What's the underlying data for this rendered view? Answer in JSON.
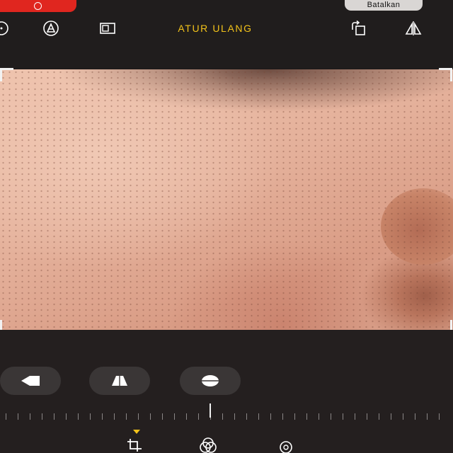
{
  "header": {
    "cancel_label": "Batalkan",
    "reset_label": "ATUR ULANG",
    "tools": [
      "auto-enhance-icon",
      "markup-icon",
      "aspect-ratio-icon",
      "rotate-icon",
      "flip-icon"
    ]
  },
  "photo": {
    "subject": ""
  },
  "adjustments": {
    "buttons": [
      "straighten-icon",
      "vertical-perspective-icon",
      "horizontal-perspective-icon"
    ]
  },
  "tabs": {
    "active": "crop",
    "items": [
      "crop-tab-icon",
      "filters-tab-icon",
      "adjust-tab-icon"
    ]
  },
  "colors": {
    "accent": "#f2c21a",
    "recording": "#e0261f",
    "background": "#1e1b1b"
  }
}
